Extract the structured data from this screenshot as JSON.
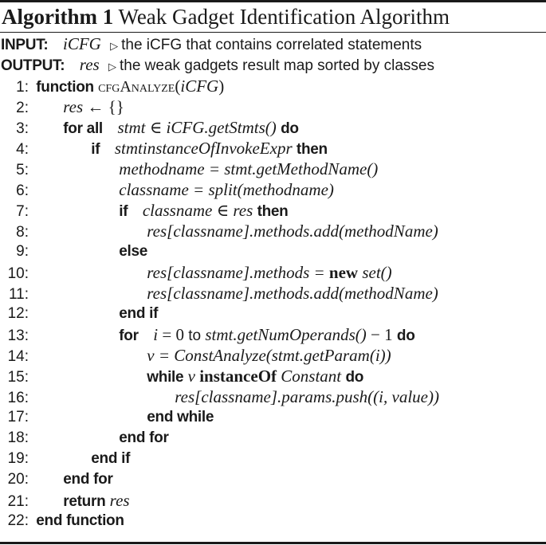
{
  "caption": {
    "label": "Algorithm 1",
    "title": "Weak Gadget Identification Algorithm"
  },
  "input": {
    "keyword": "INPUT:",
    "var": "iCFG",
    "comment_symbol": "▷",
    "comment": "the iCFG that contains correlated statements"
  },
  "output": {
    "keyword": "OUTPUT:",
    "var": "res",
    "comment_symbol": "▷",
    "comment": "the weak gadgets result map sorted by classes"
  },
  "lines": [
    {
      "n": "1:",
      "kw": "function",
      "sc": "cfgAnalyze",
      "paren_open": "(",
      "m": "iCFG",
      "paren_close": ")"
    },
    {
      "n": "2:",
      "m": "res",
      "op": " ← {}"
    },
    {
      "n": "3:",
      "kw": "for all",
      "m": "stmt ∈ iCFG.getStmts()",
      "kw2": "do"
    },
    {
      "n": "4:",
      "kw": "if",
      "m": "stmtinstanceOfInvokeExpr",
      "kw2": "then"
    },
    {
      "n": "5:",
      "m": "methodname = stmt.getMethodName()"
    },
    {
      "n": "6:",
      "m": "classname = split(methodname)"
    },
    {
      "n": "7:",
      "kw": "if",
      "m": "classname ∈ res",
      "kw2": "then"
    },
    {
      "n": "8:",
      "m": "res[classname].methods.add(methodName)"
    },
    {
      "n": "9:",
      "kw": "else"
    },
    {
      "n": "10:",
      "m": "res[classname].methods = ",
      "mb": "new",
      "m2": " set()"
    },
    {
      "n": "11:",
      "m": "res[classname].methods.add(methodName)"
    },
    {
      "n": "12:",
      "kw": "end if"
    },
    {
      "n": "13:",
      "kw": "for",
      "m": "i",
      "mr": " = 0",
      "cm": " to ",
      "m2": "stmt.getNumOperands()",
      "mr2": " − 1",
      "kw2": "do"
    },
    {
      "n": "14:",
      "m": "v = ConstAnalyze(stmt.getParam(i))"
    },
    {
      "n": "15:",
      "mb": "while",
      "m": "v",
      "mb2": "instanceOf",
      "m2": "Constant",
      "kw2": "do"
    },
    {
      "n": "16:",
      "m": "res[classname].params.push((i, value))"
    },
    {
      "n": "17:",
      "kw": "end while"
    },
    {
      "n": "18:",
      "kw": "end for"
    },
    {
      "n": "19:",
      "kw": "end if"
    },
    {
      "n": "20:",
      "kw": "end for"
    },
    {
      "n": "21:",
      "kw": "return",
      "m": "res"
    },
    {
      "n": "22:",
      "kw": "end function"
    }
  ]
}
